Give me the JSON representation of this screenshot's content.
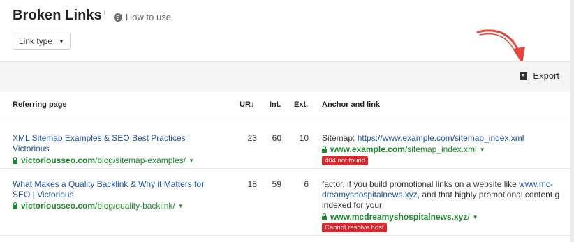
{
  "header": {
    "title": "Broken Links",
    "sup": "i",
    "howto_label": "How to use",
    "howto_icon": "question-circle-icon"
  },
  "filter": {
    "label": "Link type"
  },
  "toolbar": {
    "export_label": "Export",
    "export_icon": "download-icon"
  },
  "columns": {
    "referring_page": "Referring page",
    "ur": "UR",
    "ur_sort": "↓",
    "int": "Int.",
    "ext": "Ext.",
    "anchor": "Anchor and link"
  },
  "rows": [
    {
      "title": "XML Sitemap Examples & SEO Best Practices | Victorious",
      "domain": "victoriousseo.com",
      "path": "/blog/sitemap-examples/",
      "ur": "23",
      "int": "60",
      "ext": "10",
      "anchor_prefix": "Sitemap: ",
      "anchor_link": "https://www.example.com/sitemap_index.xml",
      "target_domain": "www.example.com",
      "target_path": "/sitemap_index.xml",
      "status": "404 not found"
    },
    {
      "title": "What Makes a Quality Backlink & Why it Matters for SEO | Victorious",
      "domain": "victoriousseo.com",
      "path": "/blog/quality-backlink/",
      "ur": "18",
      "int": "59",
      "ext": "6",
      "anchor_line1": "factor, if you build promotional links on a website like ",
      "anchor_line1_link": "www.mc-",
      "anchor_line2_link": "dreamyshospitalnews.xyz",
      "anchor_line2": ", and that highly promotional content g",
      "anchor_line3": "indexed for your",
      "target_domain": "www.mcdreamyshospitalnews.xyz",
      "target_path": "/",
      "status": "Cannot resolve host"
    }
  ],
  "colors": {
    "link": "#1c4fa8",
    "url_green": "#1b8a2f",
    "badge_red": "#e0262a",
    "arrow_red": "#e8463c"
  }
}
